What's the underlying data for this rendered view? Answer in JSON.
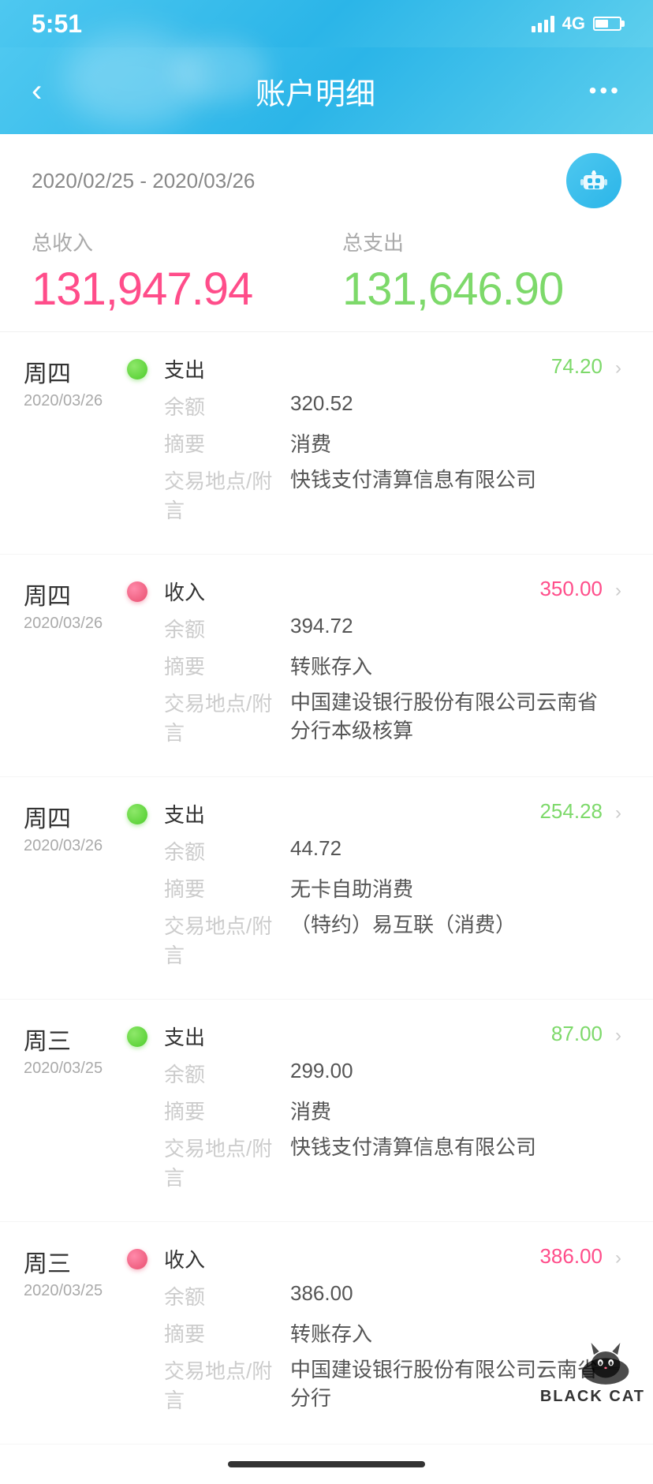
{
  "statusBar": {
    "time": "5:51",
    "network": "4G"
  },
  "header": {
    "title": "账户明细",
    "backLabel": "‹",
    "moreLabel": "•••"
  },
  "summary": {
    "dateRange": "2020/02/25 - 2020/03/26",
    "incomeLabel": "总收入",
    "expenseLabel": "总支出",
    "totalIncome": "131,947.94",
    "totalExpense": "131,646.90"
  },
  "transactions": [
    {
      "dayName": "周四",
      "date": "2020/03/26",
      "type": "支出",
      "typeColor": "green",
      "amount": "74.20",
      "amountColor": "green",
      "balance": "320.52",
      "summary": "消费",
      "location": "快钱支付清算信息有限公司"
    },
    {
      "dayName": "周四",
      "date": "2020/03/26",
      "type": "收入",
      "typeColor": "pink",
      "amount": "350.00",
      "amountColor": "pink",
      "balance": "394.72",
      "summary": "转账存入",
      "location": "中国建设银行股份有限公司云南省分行本级核算"
    },
    {
      "dayName": "周四",
      "date": "2020/03/26",
      "type": "支出",
      "typeColor": "green",
      "amount": "254.28",
      "amountColor": "green",
      "balance": "44.72",
      "summary": "无卡自助消费",
      "location": "（特约）易互联（消费）"
    },
    {
      "dayName": "周三",
      "date": "2020/03/25",
      "type": "支出",
      "typeColor": "green",
      "amount": "87.00",
      "amountColor": "green",
      "balance": "299.00",
      "summary": "消费",
      "location": "快钱支付清算信息有限公司"
    },
    {
      "dayName": "周三",
      "date": "2020/03/25",
      "type": "收入",
      "typeColor": "pink",
      "amount": "386.00",
      "amountColor": "pink",
      "balance": "386.00",
      "summary": "转账存入",
      "location": "中国建设银行股份有限公司云南省分行"
    }
  ],
  "labels": {
    "balance": "余额",
    "summary": "摘要",
    "location": "交易地点/附言"
  },
  "blackCat": {
    "text": "BLACK CAT"
  }
}
